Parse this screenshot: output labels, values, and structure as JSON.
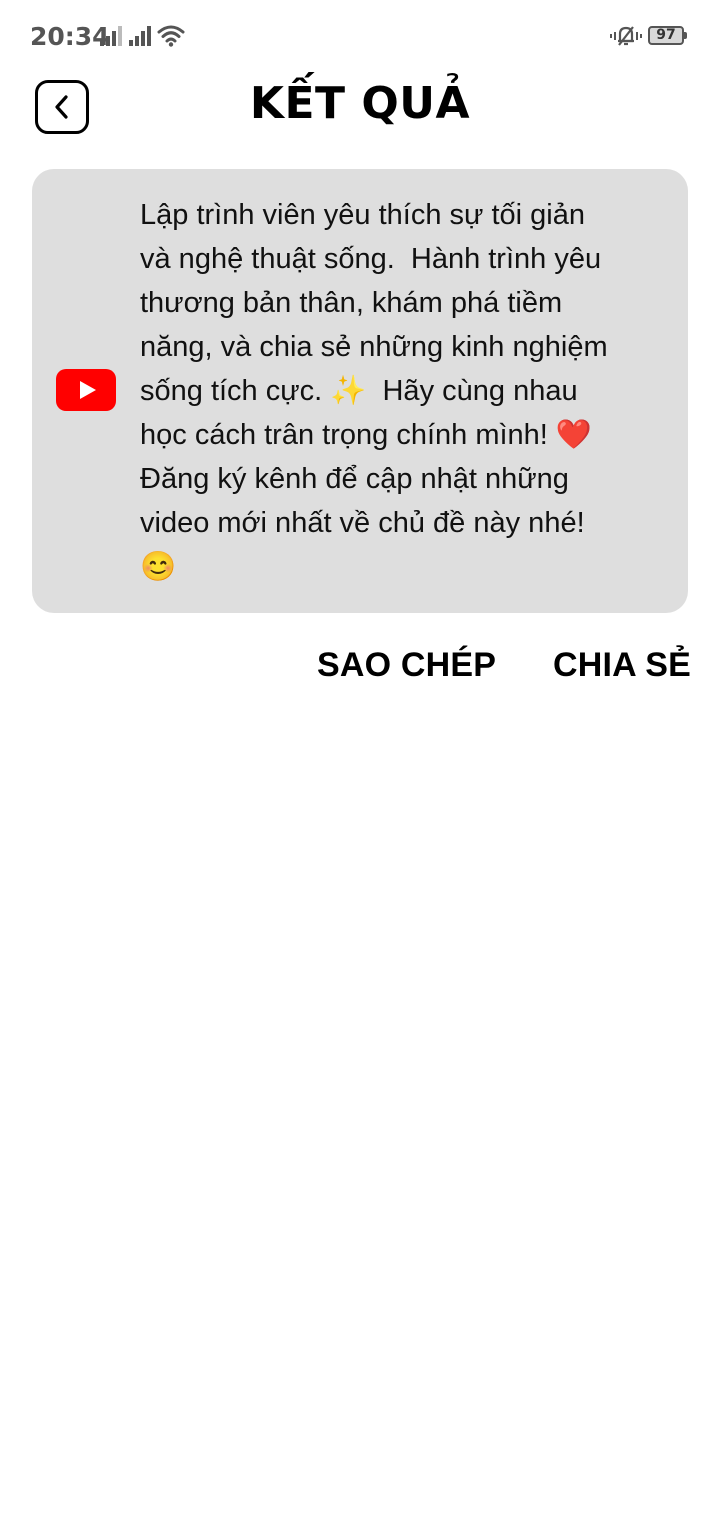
{
  "status_bar": {
    "time": "20:34",
    "battery": "97",
    "icons": [
      "signal-icon",
      "signal-icon",
      "wifi-icon",
      "vibrate-icon",
      "battery-icon"
    ]
  },
  "header": {
    "title": "KẾT QUẢ",
    "back_icon": "chevron-left-icon"
  },
  "result": {
    "source_icon": "youtube-icon",
    "text": "Lập trình viên yêu thích sự tối giản\nvà nghệ thuật sống.  Hành trình yêu\nthương bản thân, khám phá tiềm\nnăng, và chia sẻ những kinh nghiệm\nsống tích cực. ✨  Hãy cùng nhau\nhọc cách trân trọng chính mình! ❤️\nĐăng ký kênh để cập nhật những\nvideo mới nhất về chủ đề này nhé!\n😊"
  },
  "actions": {
    "copy_label": "SAO CHÉP",
    "share_label": "CHIA SẺ"
  },
  "colors": {
    "card_bg": "#dedede",
    "youtube_red": "#ff0000",
    "text": "#000000"
  }
}
